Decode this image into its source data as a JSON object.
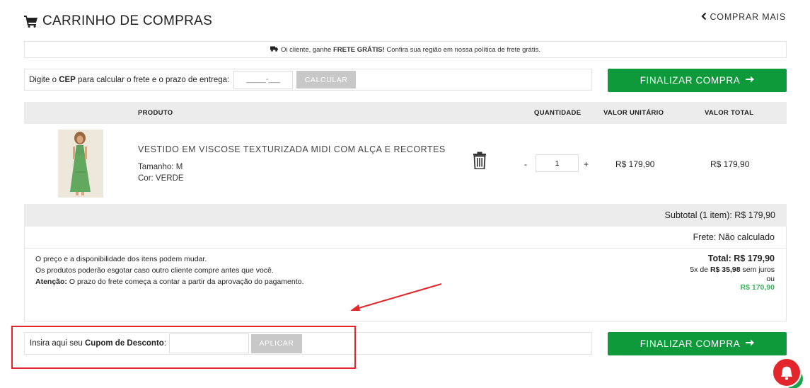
{
  "header": {
    "title": "CARRINHO DE COMPRAS",
    "back_label": "COMPRAR MAIS",
    "cart_icon": "cart-icon",
    "back_icon": "chevron-left-icon"
  },
  "banner": {
    "icon": "truck-icon",
    "text_pre": "Oi cliente, ganhe ",
    "text_bold": "FRETE GRÁTIS!",
    "text_post": " Confira sua região em nossa política de frete grátis."
  },
  "shipping": {
    "label_pre": "Digite o ",
    "label_bold": "CEP",
    "label_post": " para calcular o frete e o prazo de entrega:",
    "cep_placeholder": "_____-___",
    "button_label": "CALCULAR"
  },
  "checkout": {
    "label": "FINALIZAR COMPRA",
    "icon": "arrow-right-icon"
  },
  "table": {
    "headers": {
      "product": "PRODUTO",
      "quantity": "QUANTIDADE",
      "unit_price": "VALOR UNITÁRIO",
      "total_price": "VALOR TOTAL"
    },
    "items": [
      {
        "name": "VESTIDO EM VISCOSE TEXTURIZADA MIDI COM ALÇA E RECORTES",
        "size": "Tamanho: M",
        "color": "Cor: VERDE",
        "quantity": "1",
        "unit_price": "R$ 179,90",
        "total_price": "R$ 179,90",
        "minus": "-",
        "plus": "+"
      }
    ]
  },
  "summary": {
    "subtotal": "Subtotal (1 item): R$ 179,90",
    "frete": "Frete: Não calculado",
    "notes": [
      "O preço e a disponibilidade dos itens podem mudar.",
      "Os produtos poderão esgotar caso outro cliente compre antes que você."
    ],
    "attention_label": "Atenção:",
    "attention_text": " O prazo do frete começa a contar a partir da aprovação do pagamento.",
    "total": "Total: R$ 179,90",
    "installments_pre": "5x de ",
    "installments_value": "R$ 35,98",
    "installments_post": " sem juros",
    "or": "ou",
    "cash_price": "R$ 170,90"
  },
  "coupon": {
    "label_pre": "Insira aqui seu ",
    "label_bold": "Cupom de Desconto",
    "label_post": ":",
    "placeholder": "",
    "button_label": "APLICAR"
  },
  "colors": {
    "green": "#0e9a3b",
    "annotation_red": "#e3262b",
    "cash_price": "#3cb35a"
  }
}
